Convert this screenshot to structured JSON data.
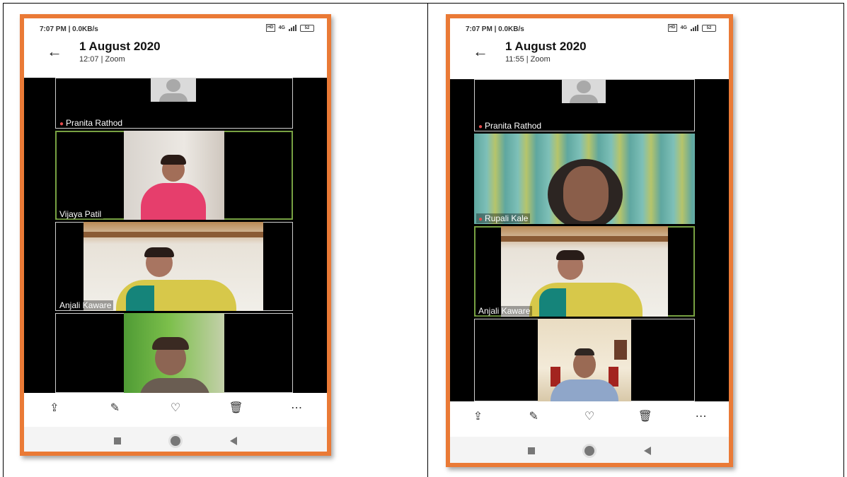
{
  "screens": [
    {
      "status": {
        "time": "7:07 PM | 0.0KB/s",
        "signal_label": "4G",
        "battery": "52"
      },
      "header": {
        "title": "1 August 2020",
        "subtitle": "12:07 | Zoom"
      },
      "participants": [
        {
          "name": "Pranita Rathod",
          "muted": true
        },
        {
          "name": "Vijaya Patil",
          "muted": false
        },
        {
          "name": "Anjali Kaware",
          "muted": false
        },
        {
          "name": "",
          "muted": false
        }
      ]
    },
    {
      "status": {
        "time": "7:07 PM | 0.0KB/s",
        "signal_label": "4G",
        "battery": "52"
      },
      "header": {
        "title": "1 August 2020",
        "subtitle": "11:55 | Zoom"
      },
      "participants": [
        {
          "name": "Pranita Rathod",
          "muted": true
        },
        {
          "name": "Rupali Kale",
          "muted": true
        },
        {
          "name": "Anjali Kaware",
          "muted": false
        },
        {
          "name": "",
          "muted": false
        }
      ]
    }
  ],
  "icons": {
    "back": "←",
    "mic_muted": "🎤",
    "share": "⇪",
    "edit": "✎",
    "favorite": "♡",
    "delete": "🗑",
    "more": "⋯"
  },
  "colors": {
    "frame": "#ea7a36",
    "active_speaker": "#77a142",
    "video_bg": "#000000"
  }
}
